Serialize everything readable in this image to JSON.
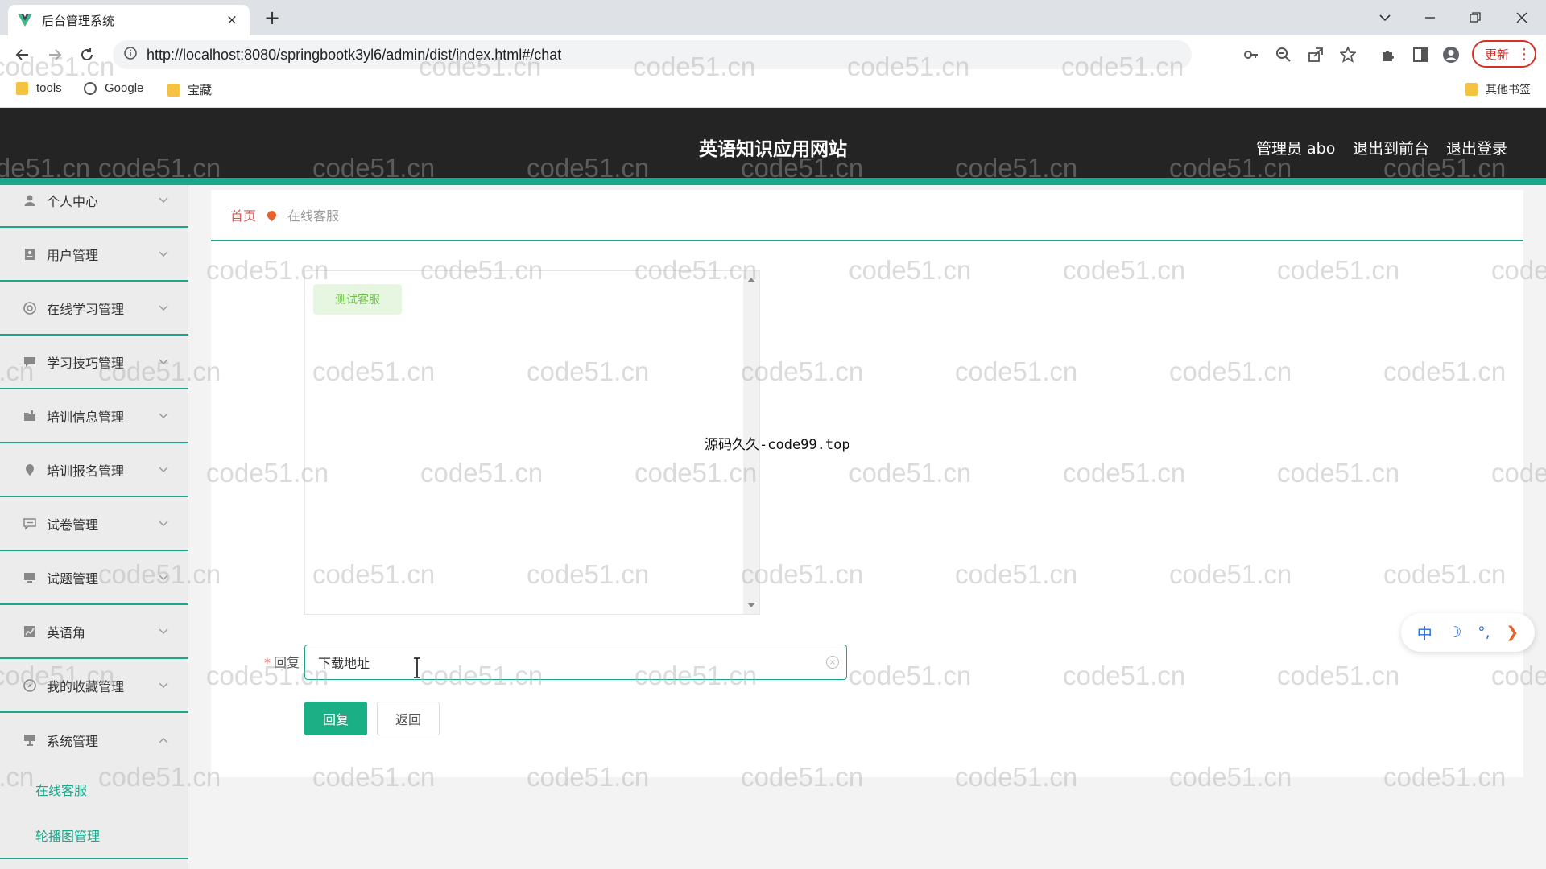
{
  "browser": {
    "tab_title": "后台管理系统",
    "tab_close": "×",
    "new_tab": "+",
    "url": "http://localhost:8080/springbootk3yl6/admin/dist/index.html#/chat",
    "update_label": "更新",
    "bookmarks": [
      "tools",
      "Google",
      "宝藏"
    ],
    "other_bookmarks": "其他书签"
  },
  "header": {
    "site_title": "英语知识应用网站",
    "admin_label": "管理员 abo",
    "to_frontend": "退出到前台",
    "logout": "退出登录",
    "accent_color": "#1aa68a"
  },
  "sidebar": {
    "items": [
      {
        "label": "个人中心",
        "icon": "person-icon"
      },
      {
        "label": "用户管理",
        "icon": "user-card-icon"
      },
      {
        "label": "在线学习管理",
        "icon": "lifebuoy-icon"
      },
      {
        "label": "学习技巧管理",
        "icon": "chat-icon"
      },
      {
        "label": "培训信息管理",
        "icon": "folder-icon"
      },
      {
        "label": "培训报名管理",
        "icon": "pin-icon"
      },
      {
        "label": "试卷管理",
        "icon": "message-icon"
      },
      {
        "label": "试题管理",
        "icon": "monitor-icon"
      },
      {
        "label": "英语角",
        "icon": "chart-icon"
      },
      {
        "label": "我的收藏管理",
        "icon": "compass-icon"
      },
      {
        "label": "系统管理",
        "icon": "desktop-icon"
      }
    ],
    "sub_items": [
      "在线客服",
      "轮播图管理"
    ]
  },
  "breadcrumb": {
    "home": "首页",
    "current": "在线客服"
  },
  "chat": {
    "messages": [
      {
        "text": "测试客服",
        "side": "left"
      }
    ]
  },
  "overlay_text": "源码久久-code99.top",
  "form": {
    "required_mark": "*",
    "reply_label": "回复",
    "reply_value": "下载地址",
    "submit_label": "回复",
    "back_label": "返回"
  },
  "ime": {
    "lang": "中",
    "moon": "☽",
    "punct": "°,",
    "arrow": "❯"
  },
  "watermark": "code51.cn"
}
